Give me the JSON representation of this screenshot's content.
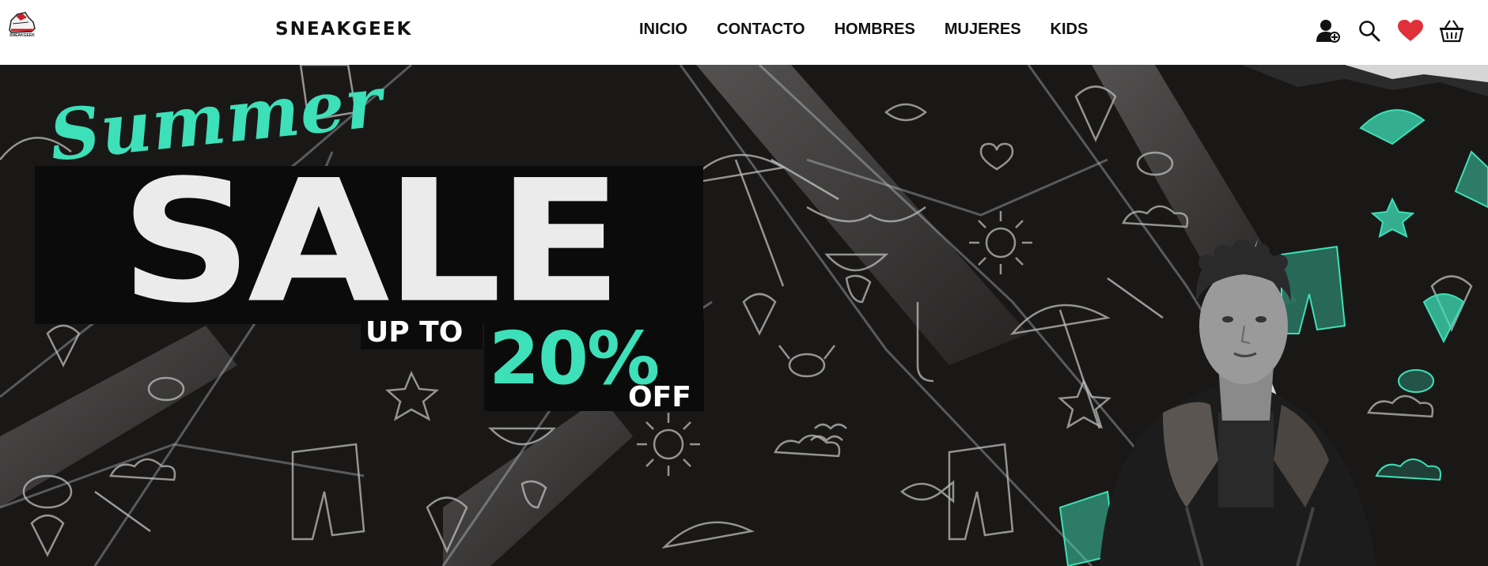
{
  "header": {
    "logo_text": "SNEAKGEEK",
    "brand": "SNEAKGEEK",
    "nav": [
      {
        "label": "INICIO"
      },
      {
        "label": "CONTACTO"
      },
      {
        "label": "HOMBRES"
      },
      {
        "label": "MUJERES"
      },
      {
        "label": "KIDS"
      }
    ],
    "icons": [
      "add-user-icon",
      "search-icon",
      "heart-icon",
      "basket-icon"
    ]
  },
  "hero": {
    "script_title": "Summer",
    "headline": "SALE",
    "up_to": "UP TO",
    "discount": "20%",
    "off": "OFF"
  },
  "colors": {
    "accent": "#3de0b8",
    "heart": "#e0303a",
    "hero_bg": "#1a1817"
  }
}
